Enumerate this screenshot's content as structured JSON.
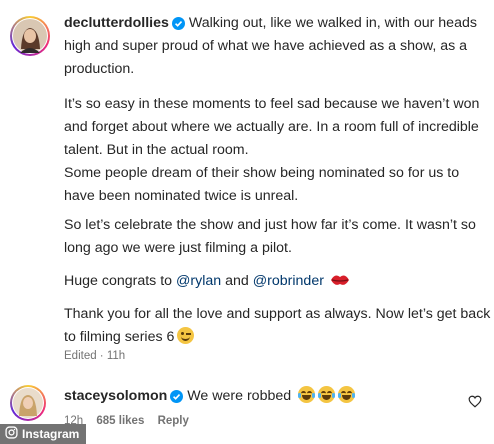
{
  "post": {
    "username": "declutterdollies",
    "line1_text": "Walking out, like we walked in, with our heads",
    "line2_text": "high and super proud of what we have achieved as a show, as a",
    "line3_text": "production.",
    "line4_text": "It’s so easy in these moments to feel sad because we haven’t won",
    "line5_text": "and forget about where we actually are. In a room full of incredible",
    "line6_text": "talent. But in the actual room.",
    "line7_text": "Some people dream of their show being nominated so for us to",
    "line8_text": "have been nominated twice is unreal.",
    "line9_text": "So let’s celebrate the show and just how far it’s come. It wasn’t so",
    "line10_text": "long ago we were just filming a pilot.",
    "congrats_prefix": "Huge congrats to",
    "mention1": "@rylan",
    "and_word": "and",
    "mention2": "@robrinder",
    "line12_text": "Thank you for all the love and support as always. Now let’s get back",
    "line13_text": "to filming series 6",
    "edited": "Edited · 11h"
  },
  "reply": {
    "username": "staceysolomon",
    "text": "We were robbed",
    "time": "12h",
    "likes": "685 likes",
    "reply_label": "Reply"
  },
  "watermark": "Instagram",
  "icons": {
    "verified": "verified-badge-icon",
    "heart": "heart-icon",
    "kiss_emoji": "kiss-lips-emoji",
    "wink_emoji": "wink-emoji",
    "laugh_emoji": "tears-of-joy-emoji"
  },
  "colors": {
    "verified": "#0095f6",
    "mention": "#00376b",
    "secondary_text": "#737373"
  }
}
